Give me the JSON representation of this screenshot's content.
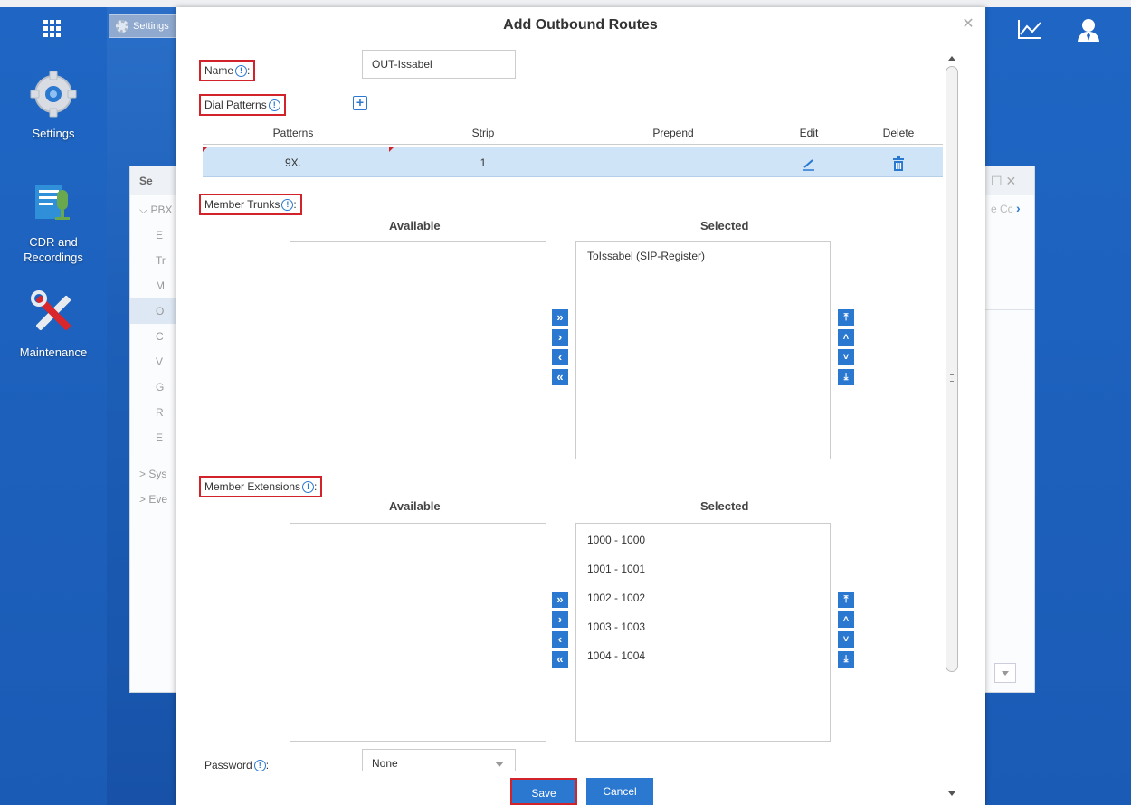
{
  "desktop": {
    "apps": [
      {
        "label": "Settings"
      },
      {
        "label_line1": "CDR and",
        "label_line2": "Recordings"
      },
      {
        "label": "Maintenance"
      }
    ],
    "taskbar_tab": "Settings"
  },
  "background_window": {
    "header": "Se",
    "rows": [
      "PBX",
      "E",
      "Tr",
      "M",
      "O",
      "C",
      "V",
      "G",
      "R",
      "E",
      "Sys",
      "Eve"
    ],
    "right_hint": "e Cc"
  },
  "modal": {
    "title": "Add Outbound Routes",
    "name_label": "Name",
    "name_value": "OUT-Issabel",
    "dial_patterns_label": "Dial Patterns",
    "patterns_table": {
      "headers": [
        "Patterns",
        "Strip",
        "Prepend",
        "Edit",
        "Delete"
      ],
      "rows": [
        {
          "pattern": "9X.",
          "strip": "1",
          "prepend": ""
        }
      ]
    },
    "member_trunks": {
      "label": "Member Trunks",
      "available_header": "Available",
      "selected_header": "Selected",
      "available": [],
      "selected": [
        "ToIssabel (SIP-Register)"
      ]
    },
    "member_extensions": {
      "label": "Member Extensions",
      "available_header": "Available",
      "selected_header": "Selected",
      "available": [],
      "selected": [
        "1000 - 1000",
        "1001 - 1001",
        "1002 - 1002",
        "1003 - 1003",
        "1004 - 1004"
      ]
    },
    "password_label": "Password",
    "password_value": "None",
    "save_label": "Save",
    "cancel_label": "Cancel"
  },
  "colors": {
    "accent": "#2b78d0",
    "highlight_box": "#d2232a",
    "selected_row": "#cfe4f7"
  }
}
